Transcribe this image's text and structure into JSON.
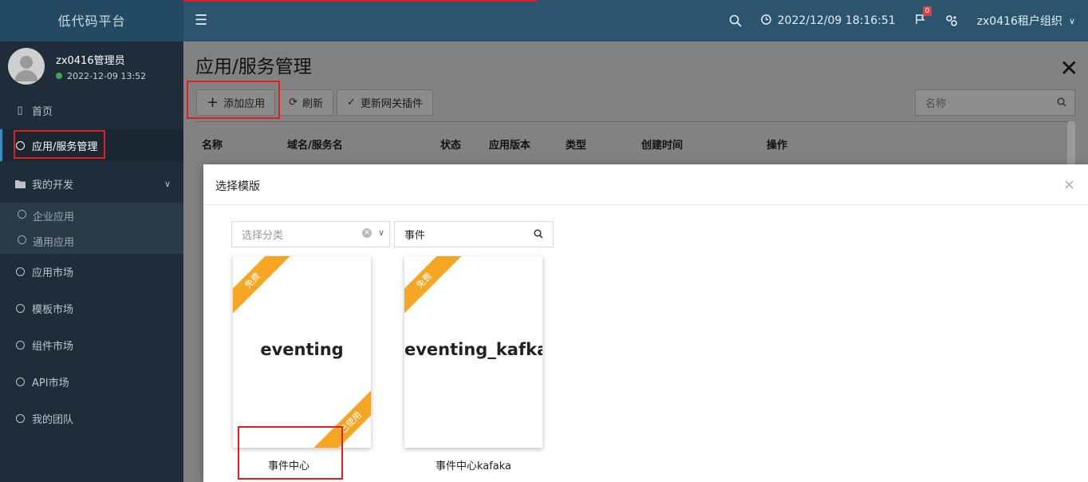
{
  "app": {
    "title": "低代码平台"
  },
  "header": {
    "menu_icon": "hamburger-icon",
    "search_icon": "search-icon",
    "datetime": "2022/12/09 18:16:51",
    "notifications_count": "0",
    "org_label": "zx0416租户组织"
  },
  "user": {
    "name": "zx0416管理员",
    "status_time": "2022-12-09 13:52"
  },
  "sidebar": {
    "items": [
      {
        "label": "首页"
      },
      {
        "label": "应用/服务管理"
      },
      {
        "label": "我的开发"
      },
      {
        "label": "应用市场"
      },
      {
        "label": "模板市场"
      },
      {
        "label": "组件市场"
      },
      {
        "label": "API市场"
      },
      {
        "label": "我的团队"
      }
    ],
    "sub_items": [
      {
        "label": "企业应用"
      },
      {
        "label": "通用应用"
      }
    ]
  },
  "page": {
    "title": "应用/服务管理",
    "toolbar": {
      "add_label": "添加应用",
      "refresh_label": "刷新",
      "update_label": "更新网关插件"
    },
    "search_placeholder": "名称",
    "columns": [
      "名称",
      "域名/服务名",
      "状态",
      "应用版本",
      "类型",
      "创建时间",
      "操作"
    ]
  },
  "modal": {
    "title": "选择模版",
    "close": "×",
    "category_placeholder": "选择分类",
    "search_value": "事件",
    "templates": [
      {
        "title": "eventing",
        "ribbon_top": "免费",
        "ribbon_bottom": "已使用",
        "label": "事件中心"
      },
      {
        "title": "eventing_kafka",
        "ribbon_top": "免费",
        "label": "事件中心kafaka"
      }
    ]
  },
  "colors": {
    "accent_red": "#e02020",
    "ribbon": "#f5a623",
    "topbar": "#2b556f",
    "sidebar": "#1f2d3a"
  }
}
